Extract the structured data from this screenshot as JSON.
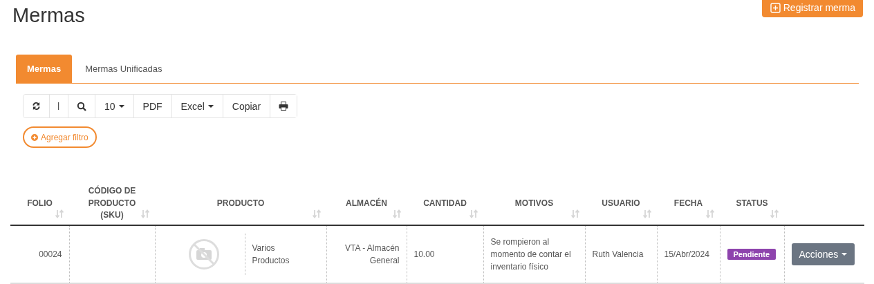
{
  "page_title": "Mermas",
  "register_button": "Registrar merma",
  "tabs": [
    {
      "label": "Mermas",
      "selected": true
    },
    {
      "label": "Mermas Unificadas",
      "selected": false
    }
  ],
  "toolbar": [
    {
      "label": "10",
      "dropdown": true
    },
    {
      "label": "PDF",
      "dropdown": false
    },
    {
      "label": "Excel",
      "dropdown": true
    },
    {
      "label": "Copiar",
      "dropdown": false
    }
  ],
  "filter_button": "Agregar filtro",
  "table": {
    "columns": [
      "FOLIO",
      "CÓDIGO DE PRODUCTO (SKU)",
      "PRODUCTO",
      "ALMACÉN",
      "CANTIDAD",
      "MOTIVOS",
      "USUARIO",
      "FECHA",
      "STATUS"
    ],
    "rows": [
      {
        "folio": "00024",
        "sku": "",
        "product": "Varios Productos",
        "warehouse": "VTA - Almacén General",
        "quantity": "10.00",
        "reason": "Se rompieron al momento de contar el inventario físico",
        "user": "Ruth Valencia",
        "date": "15/Abr/2024",
        "status": "Pendiente",
        "actions": "Acciones"
      }
    ]
  }
}
